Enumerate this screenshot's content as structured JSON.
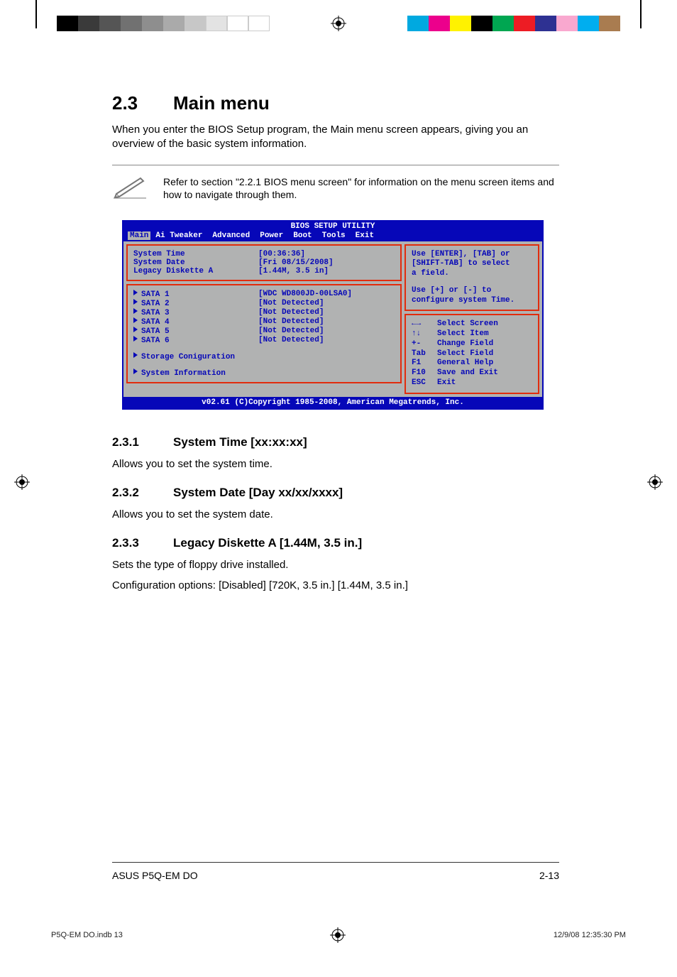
{
  "section": {
    "number": "2.3",
    "title": "Main menu",
    "intro": "When you enter the BIOS Setup program, the Main menu screen appears, giving you an overview of the basic system information."
  },
  "note": "Refer to section \"2.2.1  BIOS menu screen\" for information on the menu screen items and how to navigate through them.",
  "bios": {
    "title": "BIOS SETUP UTILITY",
    "tabs": [
      "Main",
      "Ai Tweaker",
      "Advanced",
      "Power",
      "Boot",
      "Tools",
      "Exit"
    ],
    "active_tab": "Main",
    "settings_top": [
      {
        "label": "System Time",
        "value": "[00:36:36]"
      },
      {
        "label": "System Date",
        "value": "[Fri 08/15/2008]"
      },
      {
        "label": "Legacy Diskette A",
        "value": "[1.44M, 3.5 in]"
      }
    ],
    "sata": [
      {
        "label": "SATA 1",
        "value": "[WDC WD800JD-00LSA0]"
      },
      {
        "label": "SATA 2",
        "value": "[Not Detected]"
      },
      {
        "label": "SATA 3",
        "value": "[Not Detected]"
      },
      {
        "label": "SATA 4",
        "value": "[Not Detected]"
      },
      {
        "label": "SATA 5",
        "value": "[Not Detected]"
      },
      {
        "label": "SATA 6",
        "value": "[Not Detected]"
      }
    ],
    "extra": [
      "Storage Coniguration",
      "System Information"
    ],
    "help": {
      "line1": "Use [ENTER], [TAB] or",
      "line2": "[SHIFT-TAB] to select",
      "line3": "a field.",
      "line5": "Use [+] or [-] to",
      "line6": "configure system Time."
    },
    "nav": [
      {
        "key": "←→",
        "desc": "Select Screen"
      },
      {
        "key": "↑↓",
        "desc": "Select Item"
      },
      {
        "key": "+-",
        "desc": "Change Field"
      },
      {
        "key": "Tab",
        "desc": "Select Field"
      },
      {
        "key": "F1",
        "desc": "General Help"
      },
      {
        "key": "F10",
        "desc": "Save and Exit"
      },
      {
        "key": "ESC",
        "desc": "Exit"
      }
    ],
    "footer": "v02.61 (C)Copyright 1985-2008, American Megatrends, Inc."
  },
  "subsections": [
    {
      "num": "2.3.1",
      "title": "System Time [xx:xx:xx]",
      "body": [
        "Allows you to set the system time."
      ]
    },
    {
      "num": "2.3.2",
      "title": "System Date [Day xx/xx/xxxx]",
      "body": [
        "Allows you to set the system date."
      ]
    },
    {
      "num": "2.3.3",
      "title": "Legacy Diskette A [1.44M, 3.5 in.]",
      "body": [
        "Sets the type of floppy drive installed.",
        "Configuration options: [Disabled] [720K, 3.5 in.] [1.44M, 3.5 in.]"
      ]
    }
  ],
  "footer": {
    "left": "ASUS P5Q-EM DO",
    "right": "2-13"
  },
  "prepress": {
    "file": "P5Q-EM DO.indb   13",
    "date": "12/9/08   12:35:30 PM"
  },
  "colors": {
    "grays": [
      "#000000",
      "#3a3a3a",
      "#555555",
      "#717171",
      "#8e8e8e",
      "#aaaaaa",
      "#c7c7c7",
      "#e3e3e3",
      "#ffffff",
      "#ffffff"
    ],
    "rainbow": [
      "#00a9e0",
      "#ec008c",
      "#fff200",
      "#000000",
      "#00a651",
      "#ed1c24",
      "#2e3192",
      "#f9a8cf",
      "#00aeef",
      "#a97c50"
    ]
  }
}
